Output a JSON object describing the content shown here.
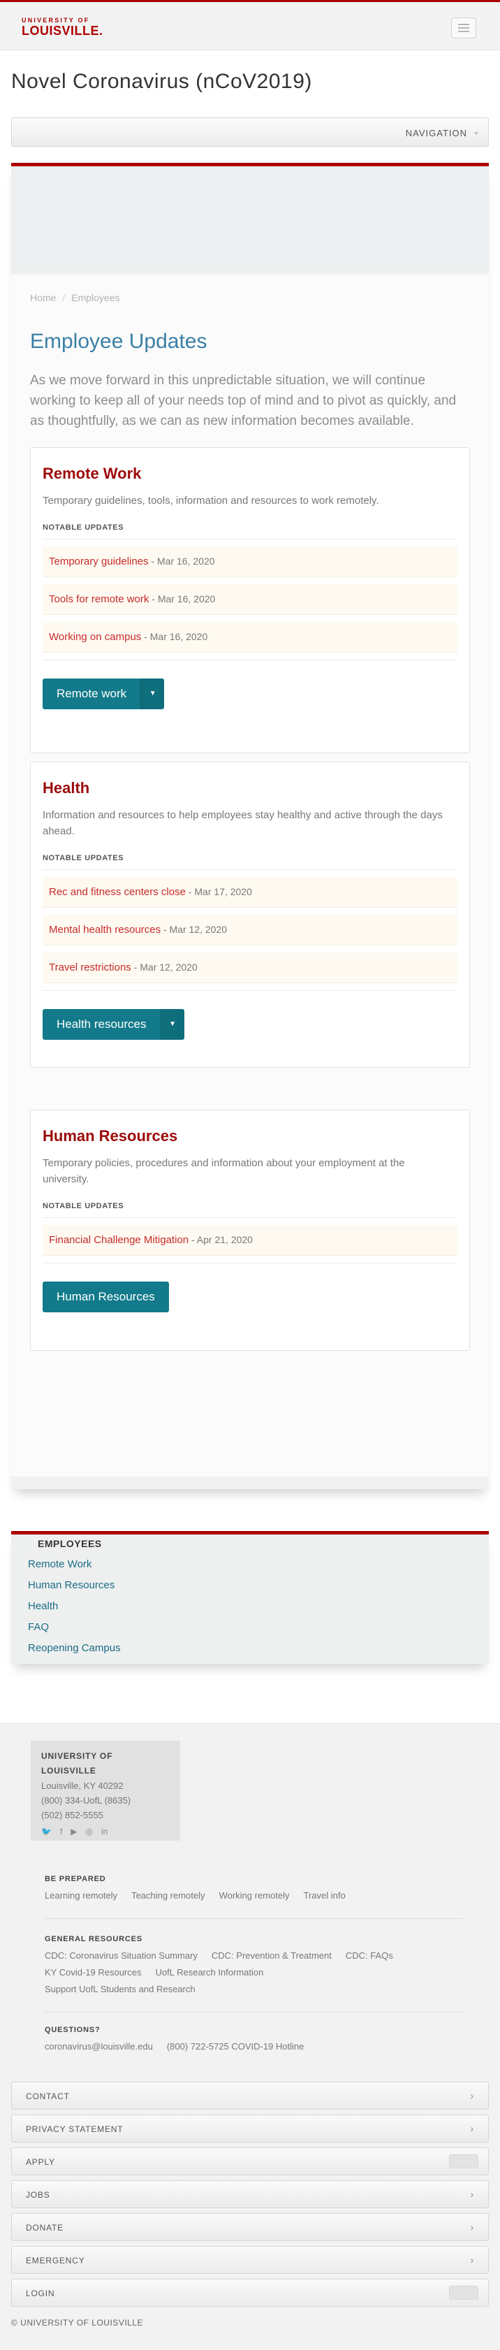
{
  "header": {
    "logo_top": "UNIVERSITY OF",
    "logo_bottom": "LOUISVILLE."
  },
  "site_title": "Novel Coronavirus (nCoV2019)",
  "navbar": {
    "label": "NAVIGATION"
  },
  "breadcrumb": {
    "home": "Home",
    "separator": "/",
    "current": "Employees"
  },
  "page": {
    "heading": "Employee Updates",
    "intro": "As we move forward in this unpredictable situation, we will continue working to keep all of your needs top of mind and to pivot as quickly, and as thoughtfully, as we can as new information becomes available."
  },
  "cards": {
    "remote": {
      "title": "Remote Work",
      "desc": "Temporary guidelines, tools, information and resources to work remotely.",
      "notable": "NOTABLE UPDATES",
      "updates": [
        {
          "title": "Temporary guidelines",
          "date": "- Mar 16, 2020"
        },
        {
          "title": "Tools for remote work",
          "date": "- Mar 16, 2020"
        },
        {
          "title": "Working on campus",
          "date": "- Mar 16, 2020"
        }
      ],
      "button": "Remote work"
    },
    "health": {
      "title": "Health",
      "desc": "Information and resources to help employees stay healthy and active through the days ahead.",
      "notable": "NOTABLE UPDATES",
      "updates": [
        {
          "title": "Rec and fitness centers close",
          "date": "- Mar 17, 2020"
        },
        {
          "title": "Mental health resources",
          "date": "- Mar 12, 2020"
        },
        {
          "title": "Travel restrictions",
          "date": "- Mar 12, 2020"
        }
      ],
      "button": "Health resources"
    },
    "hr": {
      "title": "Human Resources",
      "desc": "Temporary policies, procedures and information about your employment at the university.",
      "notable": "NOTABLE UPDATES",
      "updates": [
        {
          "title": "Financial Challenge Mitigation",
          "date": "- Apr 21, 2020"
        }
      ],
      "button": "Human Resources"
    }
  },
  "subnav": {
    "title": "EMPLOYEES",
    "items": [
      "Remote Work",
      "Human Resources",
      "Health",
      "FAQ",
      "Reopening Campus"
    ]
  },
  "footer": {
    "contact": {
      "university": "UNIVERSITY OF LOUISVILLE",
      "address": "Louisville, KY 40292",
      "phone1": "(800) 334-UofL (8635)",
      "phone2": "(502) 852-5555"
    },
    "social_icons": [
      "twitter-icon",
      "facebook-icon",
      "youtube-icon",
      "instagram-icon",
      "linkedin-icon"
    ],
    "be_prepared": {
      "title": "BE PREPARED",
      "links": [
        "Learning remotely",
        "Teaching remotely",
        "Working remotely",
        "Travel info"
      ]
    },
    "general": {
      "title": "GENERAL RESOURCES",
      "links": [
        "CDC: Coronavirus Situation Summary",
        "CDC: Prevention & Treatment",
        "CDC: FAQs",
        "KY Covid-19 Resources",
        "UofL Research Information",
        "Support UofL Students and Research"
      ]
    },
    "questions": {
      "title": "QUESTIONS?",
      "email": "coronavirus@louisville.edu",
      "hotline": "(800) 722-5725 COVID-19 Hotline"
    },
    "accordion": [
      "CONTACT",
      "PRIVACY STATEMENT",
      "APPLY",
      "JOBS",
      "DONATE",
      "EMERGENCY",
      "LOGIN"
    ],
    "copyright": "© UNIVERSITY OF LOUISVILLE"
  },
  "colors": {
    "brand_red": "#ad0000",
    "heading_blue": "#3b7fa5",
    "button_teal": "#127a8a",
    "link_red": "#c52b2b"
  }
}
